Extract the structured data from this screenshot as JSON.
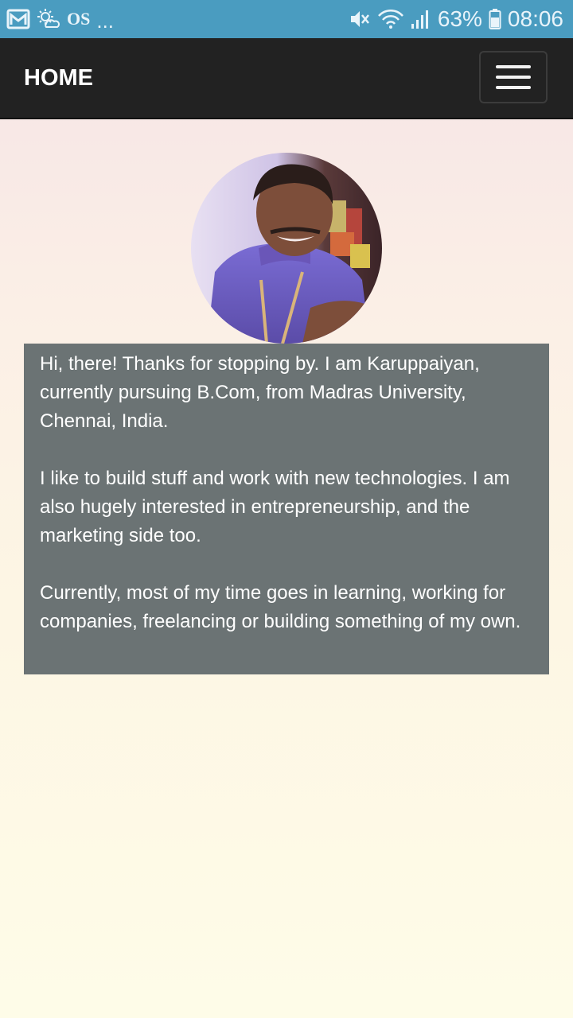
{
  "status_bar": {
    "left_icons": [
      "gmail-icon",
      "weather-icon"
    ],
    "os_label": "OS",
    "overflow": "...",
    "battery": "63%",
    "time": "08:06",
    "right_icons": [
      "mute-icon",
      "wifi-icon",
      "signal-icon",
      "battery-icon"
    ]
  },
  "navbar": {
    "brand": "HOME",
    "menu_icon": "hamburger-icon"
  },
  "profile": {
    "avatar": "profile-photo"
  },
  "about": {
    "paragraphs": [
      "Hi, there! Thanks for stopping by. I am Karuppaiyan, currently pursuing B.Com, from Madras University, Chennai, India.",
      "I like to build stuff and work with new technologies. I am also hugely interested in entrepreneurship, and the marketing side too.",
      "Currently, most of my time goes in learning, working for companies, freelancing or building something of my own."
    ]
  },
  "colors": {
    "status_bar": "#4a9cc0",
    "navbar": "#222222",
    "about_box": "#6b7374"
  }
}
